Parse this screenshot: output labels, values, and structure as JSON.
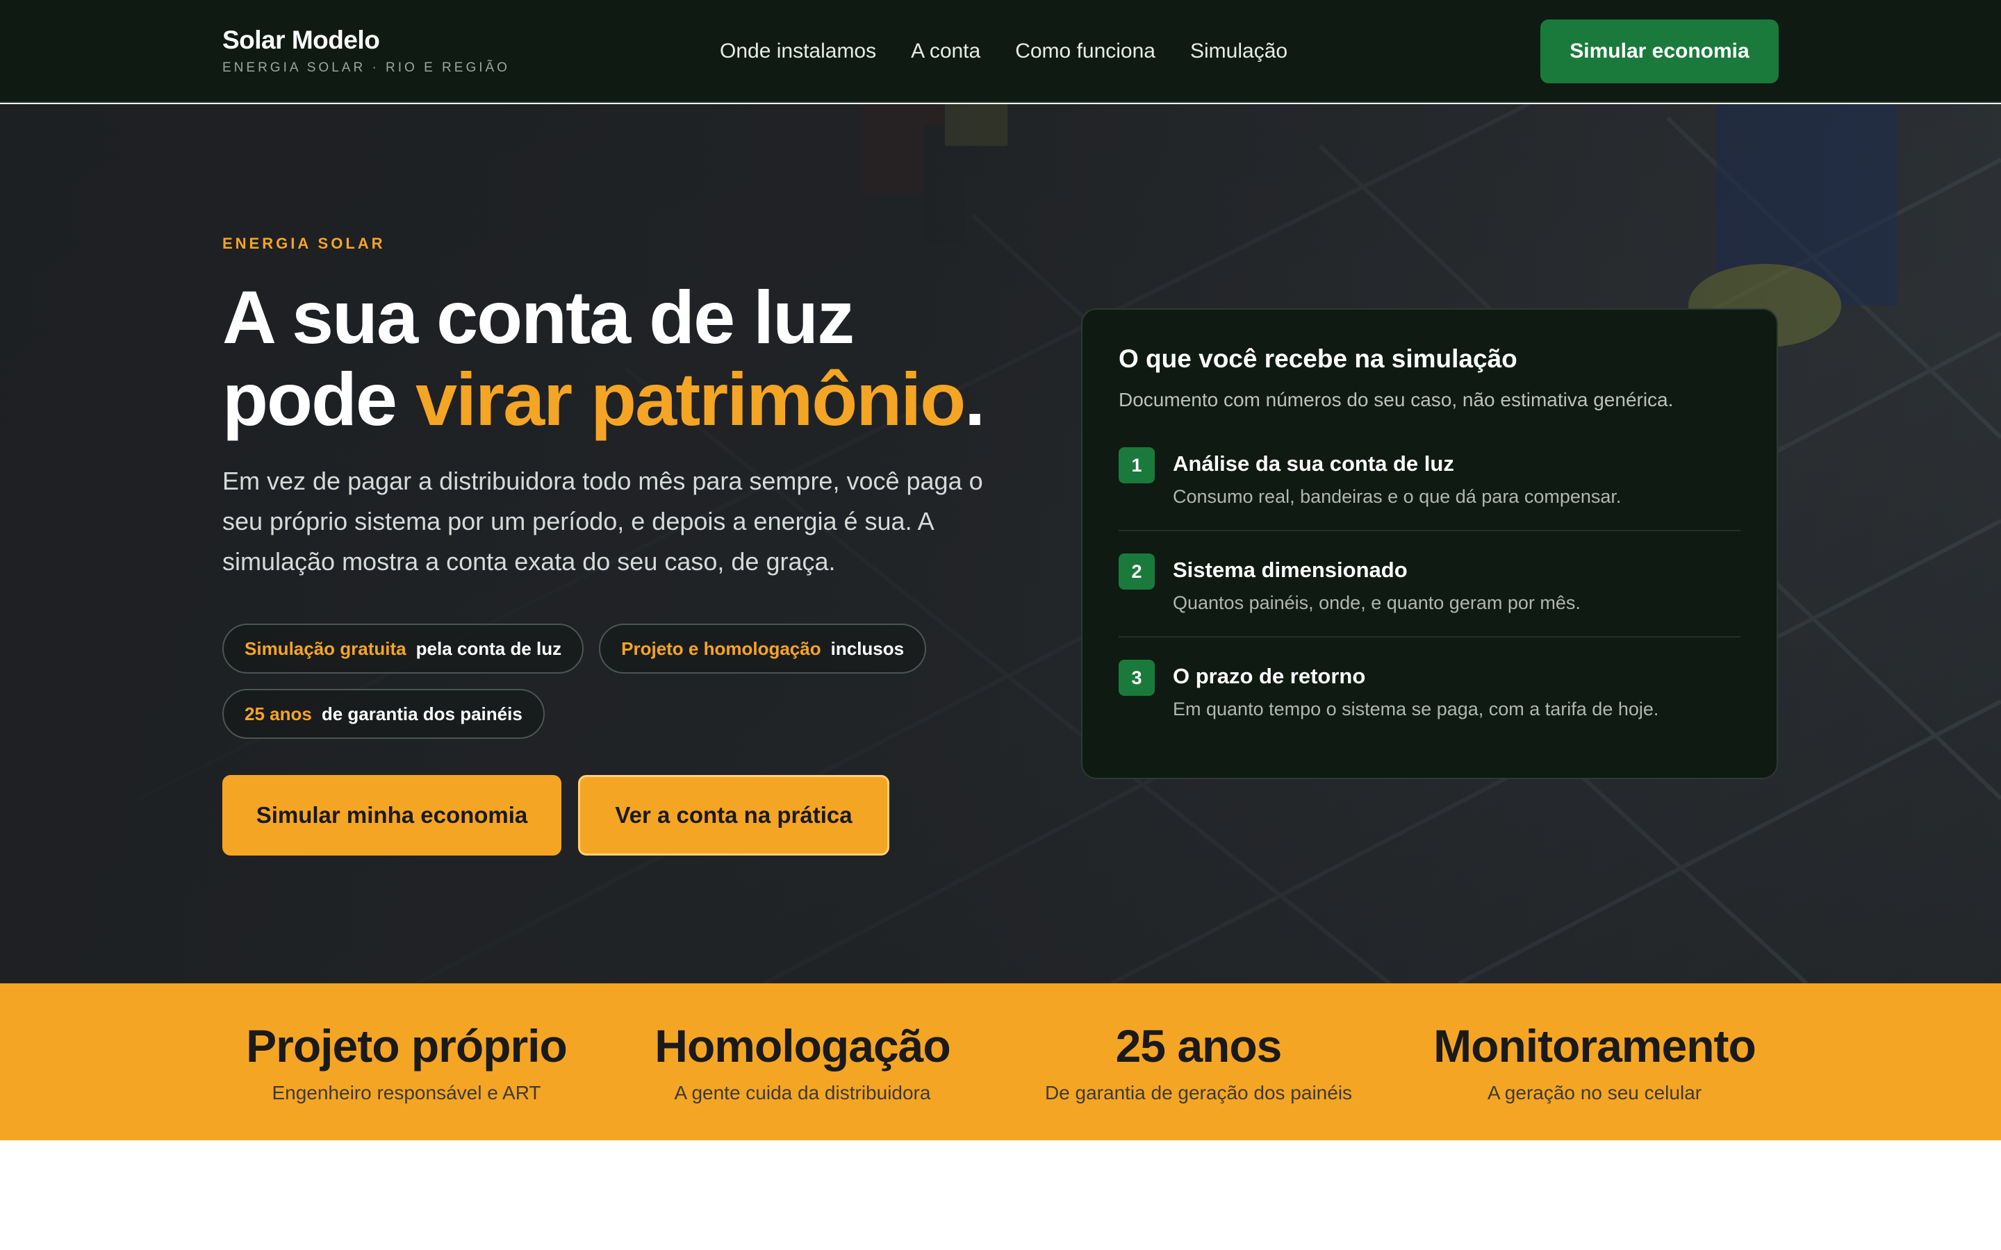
{
  "header": {
    "brand_name": "Solar Modelo",
    "brand_tagline": "ENERGIA SOLAR · RIO E REGIÃO",
    "nav": [
      "Onde instalamos",
      "A conta",
      "Como funciona",
      "Simulação"
    ],
    "cta_label": "Simular economia"
  },
  "hero": {
    "eyebrow": "ENERGIA SOLAR",
    "title_line1": "A sua conta de luz",
    "title_line2_prefix": "pode ",
    "title_line2_accent": "virar patrimônio",
    "title_line2_suffix": ".",
    "description": "Em vez de pagar a distribuidora todo mês para sempre, você paga o seu próprio sistema por um período, e depois a energia é sua. A simulação mostra a conta exata do seu caso, de graça.",
    "chips": [
      {
        "strong": "Simulação gratuita",
        "rest": "pela conta de luz"
      },
      {
        "strong": "Projeto e homologação",
        "rest": "inclusos"
      },
      {
        "strong": "25 anos",
        "rest": "de garantia dos painéis"
      }
    ],
    "primary_button": "Simular minha economia",
    "secondary_button": "Ver a conta na prática"
  },
  "card": {
    "title": "O que você recebe na simulação",
    "subtitle": "Documento com números do seu caso, não estimativa genérica.",
    "steps": [
      {
        "num": "1",
        "title": "Análise da sua conta de luz",
        "desc": "Consumo real, bandeiras e o que dá para compensar."
      },
      {
        "num": "2",
        "title": "Sistema dimensionado",
        "desc": "Quantos painéis, onde, e quanto geram por mês."
      },
      {
        "num": "3",
        "title": "O prazo de retorno",
        "desc": "Em quanto tempo o sistema se paga, com a tarifa de hoje."
      }
    ]
  },
  "stats": [
    {
      "title": "Projeto próprio",
      "desc": "Engenheiro responsável e ART"
    },
    {
      "title": "Homologação",
      "desc": "A gente cuida da distribuidora"
    },
    {
      "title": "25 anos",
      "desc": "De garantia de geração dos painéis"
    },
    {
      "title": "Monitoramento",
      "desc": "A geração no seu celular"
    }
  ],
  "colors": {
    "accent": "#f5a524",
    "brand_green": "#1a7a3c",
    "header_bg": "#0f1a13"
  }
}
